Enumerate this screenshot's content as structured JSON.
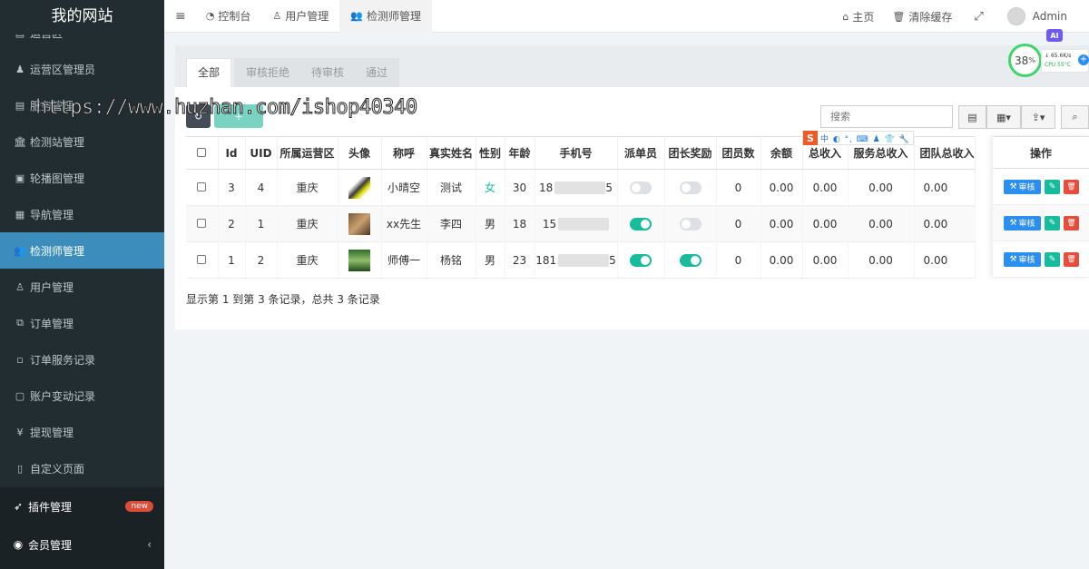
{
  "brand": "我的网站",
  "sidebar": {
    "items": [
      {
        "label": "运营区",
        "icon": "list-icon"
      },
      {
        "label": "运营区管理员",
        "icon": "user-icon"
      },
      {
        "label": "服务管理",
        "icon": "list-icon"
      },
      {
        "label": "检测站管理",
        "icon": "bank-icon"
      },
      {
        "label": "轮播图管理",
        "icon": "image-icon"
      },
      {
        "label": "导航管理",
        "icon": "grid-icon"
      },
      {
        "label": "检测师管理",
        "icon": "users-icon"
      },
      {
        "label": "用户管理",
        "icon": "user-outline-icon"
      },
      {
        "label": "订单管理",
        "icon": "copy-icon"
      },
      {
        "label": "订单服务记录",
        "icon": "save-icon"
      },
      {
        "label": "账户变动记录",
        "icon": "image-outline-icon"
      },
      {
        "label": "提现管理",
        "icon": "yen-icon"
      },
      {
        "label": "自定义页面",
        "icon": "file-icon"
      }
    ],
    "bottom": [
      {
        "label": "插件管理",
        "icon": "rocket-icon",
        "badge": "new"
      },
      {
        "label": "会员管理",
        "icon": "user-circle-icon"
      }
    ]
  },
  "topbar": {
    "tabs": [
      {
        "label": "控制台"
      },
      {
        "label": "用户管理"
      },
      {
        "label": "检测师管理"
      }
    ],
    "home": "主页",
    "clear_cache": "清除缓存",
    "admin": "Admin"
  },
  "tabs": [
    "全部",
    "审核拒绝",
    "待审核",
    "通过"
  ],
  "toolbar": {
    "search_placeholder": "搜索"
  },
  "table": {
    "headers": [
      "Id",
      "UID",
      "所属运营区",
      "头像",
      "称呼",
      "真实姓名",
      "性别",
      "年龄",
      "手机号",
      "派单员",
      "团长奖励",
      "团员数",
      "余额",
      "总收入",
      "服务总收入",
      "团队总收入"
    ],
    "action_header": "操作",
    "rows": [
      {
        "id": "3",
        "uid": "4",
        "region": "重庆",
        "nickname": "小晴空",
        "realname": "测试",
        "gender": "女",
        "age": "30",
        "phone_prefix": "18",
        "phone_suffix": "5",
        "dispatcher": false,
        "leader": false,
        "members": "0",
        "balance": "0.00",
        "income": "0.00",
        "service_income": "0.00",
        "team_income": "0.00"
      },
      {
        "id": "2",
        "uid": "1",
        "region": "重庆",
        "nickname": "xx先生",
        "realname": "李四",
        "gender": "男",
        "age": "18",
        "phone_prefix": "15",
        "phone_suffix": "",
        "dispatcher": true,
        "leader": false,
        "members": "0",
        "balance": "0.00",
        "income": "0.00",
        "service_income": "0.00",
        "team_income": "0.00"
      },
      {
        "id": "1",
        "uid": "2",
        "region": "重庆",
        "nickname": "师傅一",
        "realname": "杨铭",
        "gender": "男",
        "age": "23",
        "phone_prefix": "181",
        "phone_suffix": "5",
        "dispatcher": true,
        "leader": true,
        "members": "0",
        "balance": "0.00",
        "income": "0.00",
        "service_income": "0.00",
        "team_income": "0.00"
      }
    ],
    "audit_label": "审核"
  },
  "footer_info": "显示第 1 到第 3 条记录，总共 3 条记录",
  "watermark": "https://www.huzhan.com/ishop40340",
  "overlay": {
    "ai": "AI",
    "cpu_percent": "38",
    "cpu_percent_unit": "%",
    "net_speed": "65.6K/s",
    "cpu_temp": "CPU 55°C",
    "ime_text": "中 ◐ °, ⌨ ♟ 👕 🔧"
  },
  "colors": {
    "sidebar_bg": "#222d32",
    "active": "#3c8dbc",
    "success": "#18bc9c",
    "danger": "#e74c3c",
    "primary": "#2c8ff0"
  }
}
